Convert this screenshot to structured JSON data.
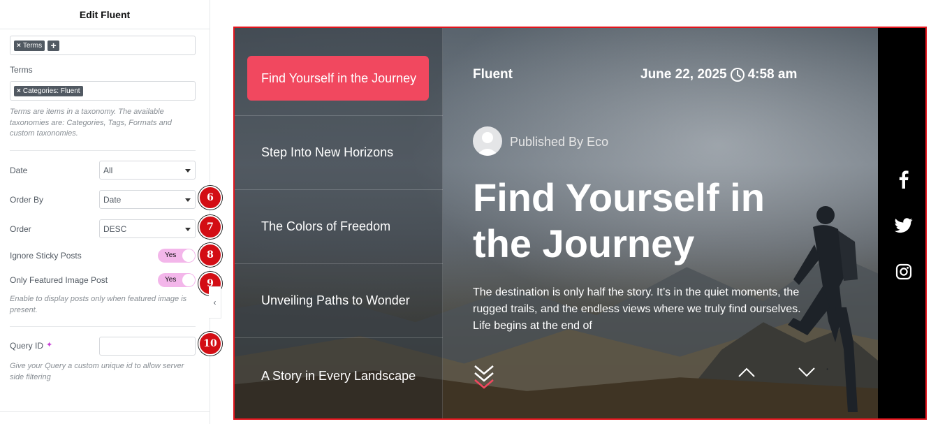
{
  "panel": {
    "title": "Edit Fluent",
    "tags_field": {
      "tag": "Terms",
      "add": "+"
    },
    "terms": {
      "label": "Terms",
      "tag": "Categories: Fluent",
      "help": "Terms are items in a taxonomy. The available taxonomies are: Categories, Tags, Formats and custom taxonomies."
    },
    "date": {
      "label": "Date",
      "value": "All"
    },
    "order_by": {
      "label": "Order By",
      "value": "Date",
      "badge": "6"
    },
    "order": {
      "label": "Order",
      "value": "DESC",
      "badge": "7"
    },
    "ignore_sticky": {
      "label": "Ignore Sticky Posts",
      "value": "Yes",
      "badge": "8"
    },
    "featured_only": {
      "label": "Only Featured Image Post",
      "value": "Yes",
      "badge": "9",
      "help": "Enable to display posts only when featured image is present."
    },
    "query_id": {
      "label": "Query ID",
      "value": "",
      "badge": "10",
      "help": "Give your Query a custom unique id to allow server side filtering"
    },
    "collapse": "‹"
  },
  "preview": {
    "nav_items": [
      "Find Yourself in the Journey",
      "Step Into New Horizons",
      "The Colors of Freedom",
      "Unveiling Paths to Wonder",
      "A Story in Every Landscape"
    ],
    "site_title": "Fluent",
    "date": "June 22, 2025",
    "time": "4:58 am",
    "author": "Published By Eco",
    "headline": "Find Yourself in the Journey",
    "excerpt": "The destination is only half the story. It’s in the quiet moments, the rugged trails, and the endless views where we truly find ourselves. Life begins at the end of",
    "social": [
      "facebook-icon",
      "twitter-icon",
      "instagram-icon"
    ]
  },
  "colors": {
    "accent": "#f1485f",
    "badge": "#d30d14",
    "toggle": "#f3b6ea",
    "frame": "#e3151d"
  }
}
